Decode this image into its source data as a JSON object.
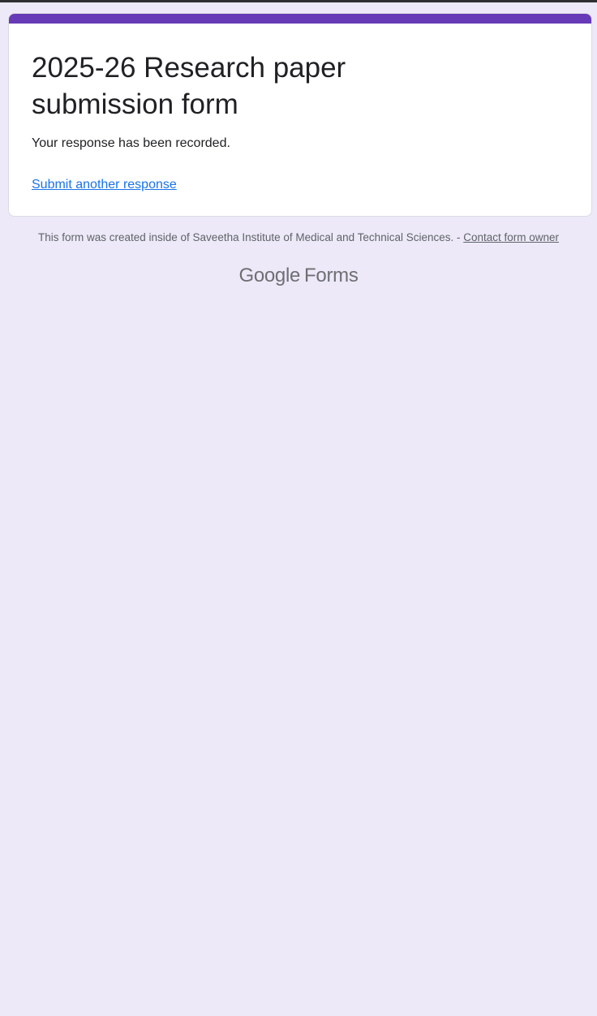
{
  "form": {
    "title": "2025-26 Research paper submission form",
    "confirmation_message": "Your response has been recorded.",
    "submit_another_label": "Submit another response",
    "accent_color": "#673ab7"
  },
  "footer": {
    "note_text": "This form was created inside of Saveetha Institute of Medical and Technical Sciences. - ",
    "contact_label": "Contact form owner"
  },
  "branding": {
    "google": "Google",
    "product": "Forms"
  },
  "colors": {
    "background": "#ede9f8",
    "link": "#1a73e8"
  }
}
